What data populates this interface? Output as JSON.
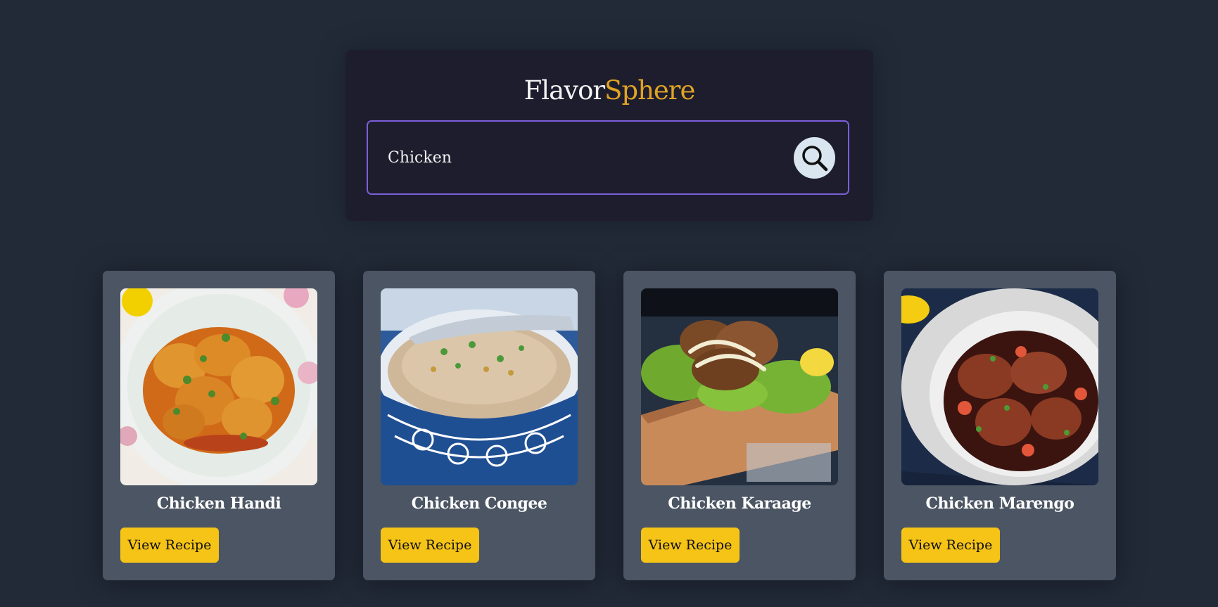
{
  "brand": {
    "part1": "Flavor",
    "part2": "Sphere"
  },
  "search": {
    "value": "Chicken",
    "button_icon": "search-icon"
  },
  "colors": {
    "page_bg": "#222a38",
    "panel_bg": "#1d1d2d",
    "accent": "#e0a325",
    "input_border": "#7c5fd9",
    "card_bg": "#4b5563",
    "button_bg": "#f6c416"
  },
  "recipes": [
    {
      "title": "Chicken Handi",
      "button": "View Recipe"
    },
    {
      "title": "Chicken Congee",
      "button": "View Recipe"
    },
    {
      "title": "Chicken Karaage",
      "button": "View Recipe"
    },
    {
      "title": "Chicken Marengo",
      "button": "View Recipe"
    }
  ]
}
